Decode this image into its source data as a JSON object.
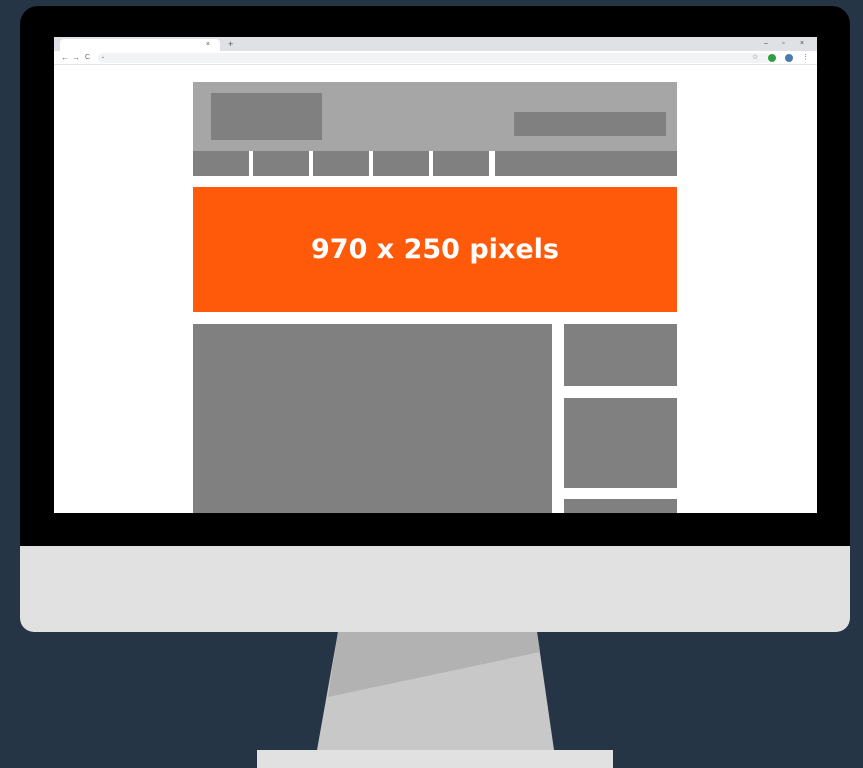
{
  "browser": {
    "tab_close_glyph": "×",
    "new_tab_glyph": "+",
    "nav": {
      "back": "←",
      "forward": "→",
      "reload": "C",
      "lock": "▪"
    },
    "window_controls": {
      "minimize": "–",
      "restore": "▫",
      "close": "×"
    },
    "bookmark_star": "☆"
  },
  "billboard_ad": {
    "label": "970 x 250 pixels",
    "color": "#ff5a0a"
  },
  "colors": {
    "background": "#253545",
    "placeholder_gray": "#808080",
    "header_gray": "#a6a6a6",
    "extension_green": "#2ea043",
    "profile_blue": "#4b7ba8"
  }
}
